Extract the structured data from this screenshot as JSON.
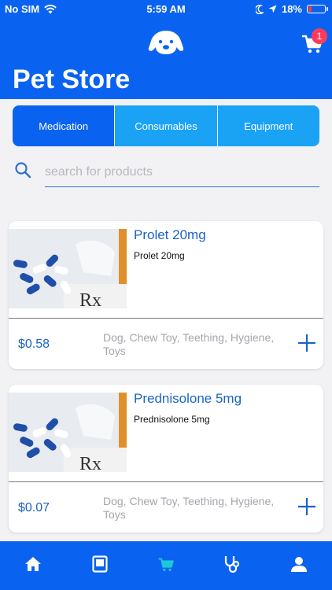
{
  "status_bar": {
    "carrier": "No SIM",
    "time": "5:59 AM",
    "battery": "18%",
    "battery_level": 0.18
  },
  "header": {
    "title": "Pet Store",
    "cart_count": "1",
    "logo_icon": "dog-face-icon",
    "cart_icon": "shopping-cart-icon"
  },
  "tabs": [
    {
      "label": "Medication",
      "active": true
    },
    {
      "label": "Consumables",
      "active": false
    },
    {
      "label": "Equipment",
      "active": false
    }
  ],
  "search": {
    "placeholder": "search for products",
    "value": ""
  },
  "products": [
    {
      "name": "Prolet 20mg",
      "description": "Prolet 20mg",
      "price": "$0.58",
      "tags": "Dog, Chew Toy, Teething, Hygiene, Toys"
    },
    {
      "name": "Prednisolone 5mg",
      "description": "Prednisolone 5mg",
      "price": "$0.07",
      "tags": "Dog, Chew Toy, Teething, Hygiene, Toys"
    }
  ],
  "bottom_nav": [
    {
      "icon": "home-icon",
      "active": false
    },
    {
      "icon": "tablet-icon",
      "active": false
    },
    {
      "icon": "shopping-cart-icon",
      "active": true
    },
    {
      "icon": "stethoscope-icon",
      "active": false
    },
    {
      "icon": "user-icon",
      "active": false
    }
  ],
  "colors": {
    "primary": "#0a63f0",
    "tab_inactive": "#1aa3f5",
    "accent_active": "#1ec8d6",
    "badge": "#ff3b5c",
    "text_link": "#1a64c8"
  }
}
